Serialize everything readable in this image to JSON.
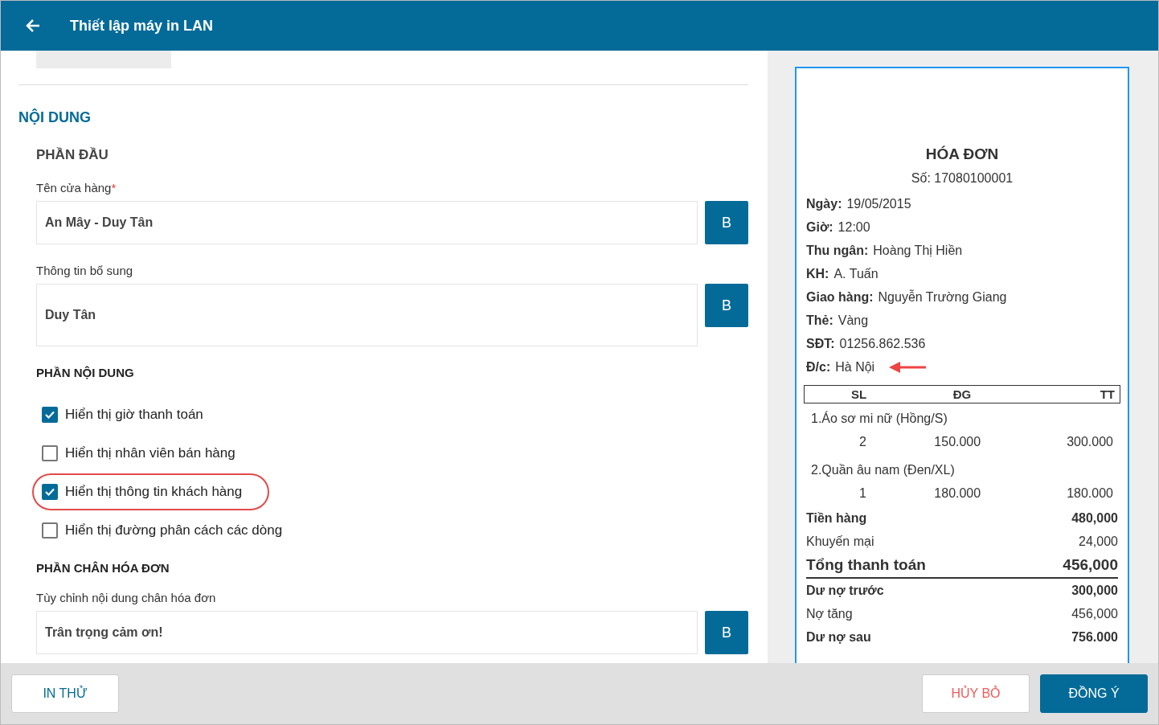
{
  "header": {
    "title": "Thiết lập máy in LAN"
  },
  "content": {
    "section_title": "NỘI DUNG",
    "header_part": {
      "title": "PHẦN ĐẦU",
      "fields": [
        {
          "label": "Tên cửa hàng",
          "required_mark": "*",
          "value": "An Mây - Duy Tân",
          "button": "B",
          "tall": false
        },
        {
          "label": "Thông tin bổ sung",
          "value": "Duy Tân",
          "button": "B",
          "tall": true
        }
      ]
    },
    "body_part": {
      "title": "PHẦN NỘI DUNG",
      "options": [
        {
          "label": "Hiển thị giờ thanh toán",
          "checked": true,
          "highlighted": false
        },
        {
          "label": "Hiển thị nhân viên bán hàng",
          "checked": false,
          "highlighted": false
        },
        {
          "label": "Hiển thị thông tin khách hàng",
          "checked": true,
          "highlighted": true
        },
        {
          "label": "Hiển thị đường phân cách các dòng",
          "checked": false,
          "highlighted": false
        }
      ]
    },
    "footer_part": {
      "title": "PHẦN CHÂN HÓA ĐƠN",
      "fields": [
        {
          "label": "Tùy chỉnh nội dung chân hóa đơn",
          "value": "Trân trọng cảm ơn!",
          "button": "B",
          "tall": false
        }
      ]
    }
  },
  "preview": {
    "title": "HÓA ĐƠN",
    "number": "Số: 17080100001",
    "info": [
      {
        "label": "Ngày:",
        "value": "19/05/2015",
        "arrow": false
      },
      {
        "label": "Giờ:",
        "value": "12:00",
        "arrow": false
      },
      {
        "label": "Thu ngân:",
        "value": "Hoàng Thị Hiền",
        "arrow": false
      },
      {
        "label": "KH:",
        "value": "A. Tuấn",
        "arrow": false
      },
      {
        "label": "Giao hàng:",
        "value": "Nguyễn Trường Giang",
        "arrow": false
      },
      {
        "label": "Thẻ:",
        "value": "Vàng",
        "arrow": false
      },
      {
        "label": "SĐT:",
        "value": "01256.862.536",
        "arrow": false
      },
      {
        "label": "Đ/c:",
        "value": "Hà Nội",
        "arrow": true
      }
    ],
    "columns": [
      "SL",
      "ĐG",
      "TT"
    ],
    "items": [
      {
        "name": "1.Áo sơ mi nữ (Hồng/S)",
        "qty": "2",
        "price": "150.000",
        "total": "300.000"
      },
      {
        "name": "2.Quần âu nam (Đen/XL)",
        "qty": "1",
        "price": "180.000",
        "total": "180.000"
      }
    ],
    "totals": [
      {
        "label": "Tiền hàng",
        "value": "480,000",
        "kind": "bold"
      },
      {
        "label": "Khuyến mại",
        "value": "24,000",
        "kind": "normal"
      },
      {
        "label": "Tổng thanh toán",
        "value": "456,000",
        "kind": "grand"
      },
      {
        "label": "Dư nợ trước",
        "value": "300,000",
        "kind": "bold"
      },
      {
        "label": "Nợ tăng",
        "value": "456,000",
        "kind": "normal"
      },
      {
        "label": "Dư nợ sau",
        "value": "756.000",
        "kind": "bold"
      }
    ]
  },
  "footer": {
    "test_button": "IN THỬ",
    "cancel_button": "HỦY BỎ",
    "ok_button": "ĐỒNG Ý"
  }
}
